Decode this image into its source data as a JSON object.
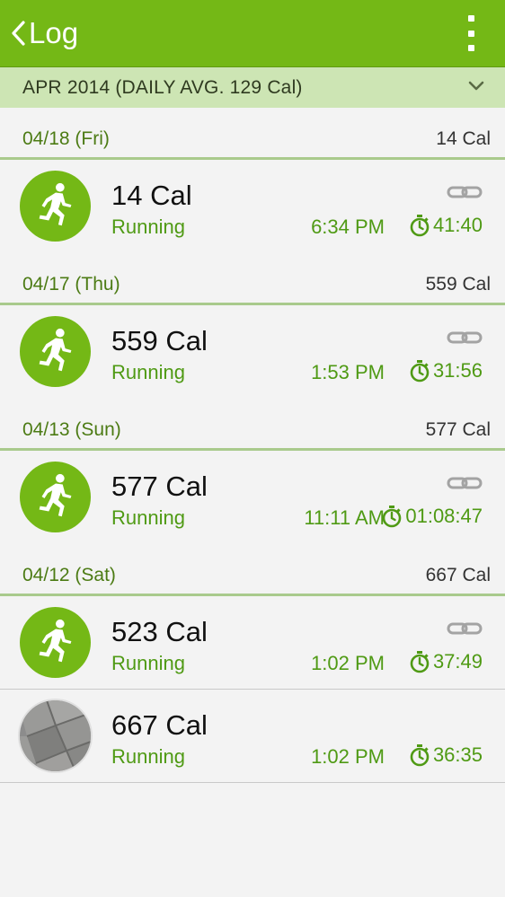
{
  "appbar": {
    "title": "Log"
  },
  "month": {
    "label": "APR 2014 (DAILY AVG. 129 Cal)"
  },
  "days": [
    {
      "date": "04/18 (Fri)",
      "total": "14 Cal",
      "entries": [
        {
          "calories": "14 Cal",
          "type": "Running",
          "time": "6:34 PM",
          "duration": "41:40",
          "icon": "running-icon",
          "linked": true
        }
      ]
    },
    {
      "date": "04/17 (Thu)",
      "total": "559 Cal",
      "entries": [
        {
          "calories": "559 Cal",
          "type": "Running",
          "time": "1:53 PM",
          "duration": "31:56",
          "icon": "running-icon",
          "linked": true
        }
      ]
    },
    {
      "date": "04/13 (Sun)",
      "total": "577 Cal",
      "entries": [
        {
          "calories": "577 Cal",
          "type": "Running",
          "time": "11:11 AM",
          "duration": "01:08:47",
          "icon": "running-icon",
          "linked": true
        }
      ]
    },
    {
      "date": "04/12 (Sat)",
      "total": "667 Cal",
      "entries": [
        {
          "calories": "523 Cal",
          "type": "Running",
          "time": "1:02 PM",
          "duration": "37:49",
          "icon": "running-icon",
          "linked": true
        },
        {
          "calories": "667 Cal",
          "type": "Running",
          "time": "1:02 PM",
          "duration": "36:35",
          "icon": "photo-thumbnail",
          "linked": false
        }
      ]
    }
  ],
  "colors": {
    "appbar": "#74b816",
    "month_bar": "#cde5b4",
    "accent_text": "#4f9a14",
    "background": "#f3f3f3"
  }
}
